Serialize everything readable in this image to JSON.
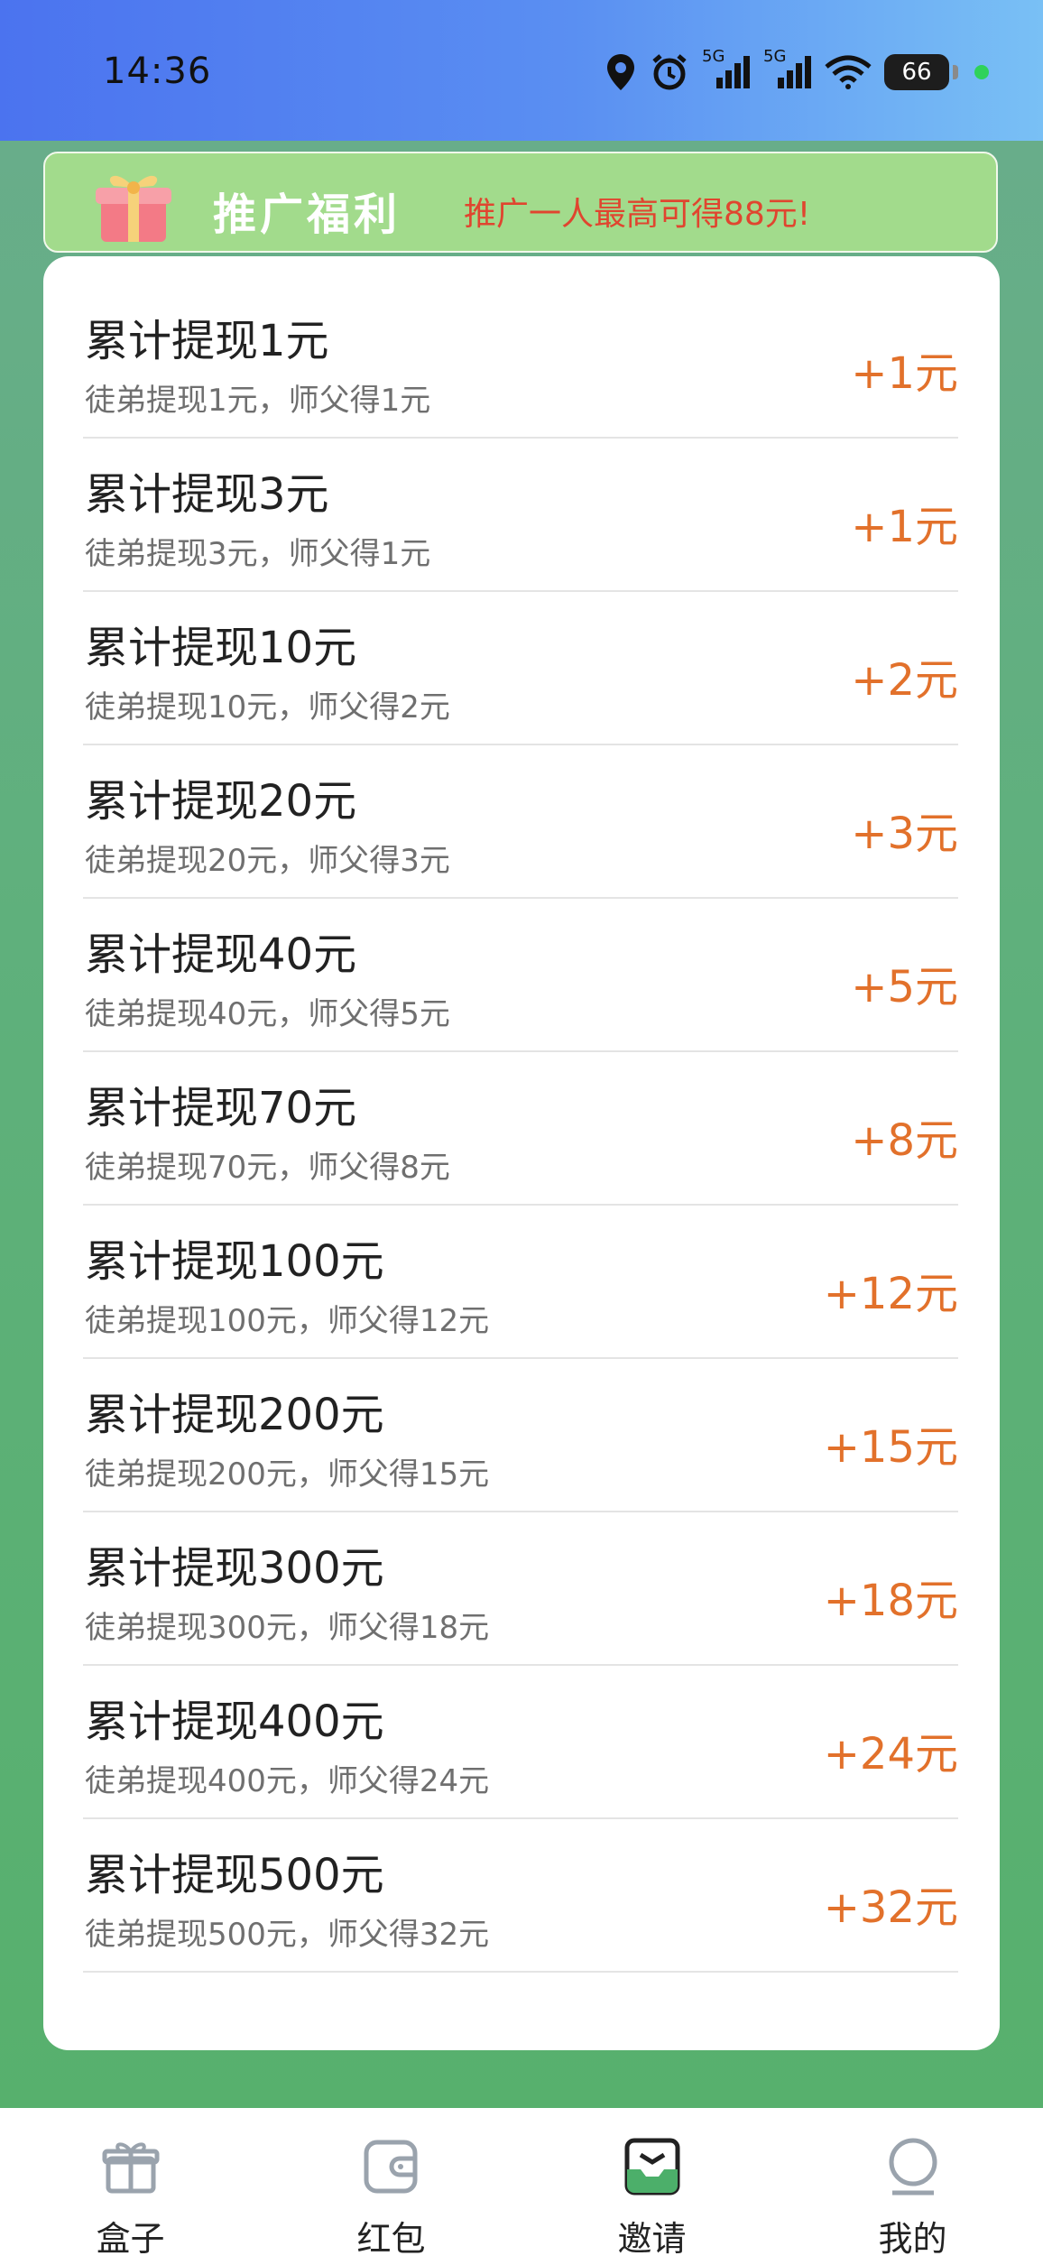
{
  "status_bar": {
    "time": "14:36",
    "battery": "66",
    "signal_1_label": "5G",
    "signal_2_label": "5G"
  },
  "banner": {
    "title": "推广福利",
    "subtitle": "推广一人最高可得88元!"
  },
  "rewards": [
    {
      "title": "累计提现1元",
      "desc": "徒弟提现1元，师父得1元",
      "reward": "+1元"
    },
    {
      "title": "累计提现3元",
      "desc": "徒弟提现3元，师父得1元",
      "reward": "+1元"
    },
    {
      "title": "累计提现10元",
      "desc": "徒弟提现10元，师父得2元",
      "reward": "+2元"
    },
    {
      "title": "累计提现20元",
      "desc": "徒弟提现20元，师父得3元",
      "reward": "+3元"
    },
    {
      "title": "累计提现40元",
      "desc": "徒弟提现40元，师父得5元",
      "reward": "+5元"
    },
    {
      "title": "累计提现70元",
      "desc": "徒弟提现70元，师父得8元",
      "reward": "+8元"
    },
    {
      "title": "累计提现100元",
      "desc": "徒弟提现100元，师父得12元",
      "reward": "+12元"
    },
    {
      "title": "累计提现200元",
      "desc": "徒弟提现200元，师父得15元",
      "reward": "+15元"
    },
    {
      "title": "累计提现300元",
      "desc": "徒弟提现300元，师父得18元",
      "reward": "+18元"
    },
    {
      "title": "累计提现400元",
      "desc": "徒弟提现400元，师父得24元",
      "reward": "+24元"
    },
    {
      "title": "累计提现500元",
      "desc": "徒弟提现500元，师父得32元",
      "reward": "+32元"
    }
  ],
  "tabs": [
    {
      "label": "盒子",
      "icon": "gift-box-icon",
      "active": false
    },
    {
      "label": "红包",
      "icon": "wallet-icon",
      "active": false
    },
    {
      "label": "邀请",
      "icon": "invite-inbox-icon",
      "active": true
    },
    {
      "label": "我的",
      "icon": "profile-icon",
      "active": false
    }
  ],
  "colors": {
    "status_gradient_start": "#4b73ef",
    "status_gradient_end": "#79c0f5",
    "page_green": "#5bb276",
    "banner_green": "#a2db8c",
    "banner_subtitle": "#e0452f",
    "reward_orange": "#e2712b",
    "active_tab_green": "#4caf6a"
  }
}
